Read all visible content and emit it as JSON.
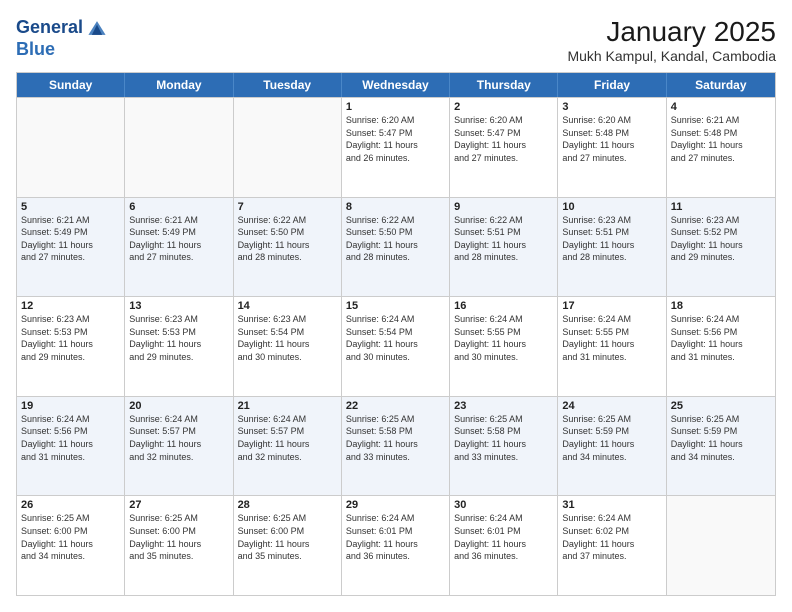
{
  "logo": {
    "line1": "General",
    "line2": "Blue"
  },
  "title": "January 2025",
  "subtitle": "Mukh Kampul, Kandal, Cambodia",
  "dayHeaders": [
    "Sunday",
    "Monday",
    "Tuesday",
    "Wednesday",
    "Thursday",
    "Friday",
    "Saturday"
  ],
  "weeks": [
    {
      "alt": false,
      "days": [
        {
          "num": "",
          "info": ""
        },
        {
          "num": "",
          "info": ""
        },
        {
          "num": "",
          "info": ""
        },
        {
          "num": "1",
          "info": "Sunrise: 6:20 AM\nSunset: 5:47 PM\nDaylight: 11 hours\nand 26 minutes."
        },
        {
          "num": "2",
          "info": "Sunrise: 6:20 AM\nSunset: 5:47 PM\nDaylight: 11 hours\nand 27 minutes."
        },
        {
          "num": "3",
          "info": "Sunrise: 6:20 AM\nSunset: 5:48 PM\nDaylight: 11 hours\nand 27 minutes."
        },
        {
          "num": "4",
          "info": "Sunrise: 6:21 AM\nSunset: 5:48 PM\nDaylight: 11 hours\nand 27 minutes."
        }
      ]
    },
    {
      "alt": true,
      "days": [
        {
          "num": "5",
          "info": "Sunrise: 6:21 AM\nSunset: 5:49 PM\nDaylight: 11 hours\nand 27 minutes."
        },
        {
          "num": "6",
          "info": "Sunrise: 6:21 AM\nSunset: 5:49 PM\nDaylight: 11 hours\nand 27 minutes."
        },
        {
          "num": "7",
          "info": "Sunrise: 6:22 AM\nSunset: 5:50 PM\nDaylight: 11 hours\nand 28 minutes."
        },
        {
          "num": "8",
          "info": "Sunrise: 6:22 AM\nSunset: 5:50 PM\nDaylight: 11 hours\nand 28 minutes."
        },
        {
          "num": "9",
          "info": "Sunrise: 6:22 AM\nSunset: 5:51 PM\nDaylight: 11 hours\nand 28 minutes."
        },
        {
          "num": "10",
          "info": "Sunrise: 6:23 AM\nSunset: 5:51 PM\nDaylight: 11 hours\nand 28 minutes."
        },
        {
          "num": "11",
          "info": "Sunrise: 6:23 AM\nSunset: 5:52 PM\nDaylight: 11 hours\nand 29 minutes."
        }
      ]
    },
    {
      "alt": false,
      "days": [
        {
          "num": "12",
          "info": "Sunrise: 6:23 AM\nSunset: 5:53 PM\nDaylight: 11 hours\nand 29 minutes."
        },
        {
          "num": "13",
          "info": "Sunrise: 6:23 AM\nSunset: 5:53 PM\nDaylight: 11 hours\nand 29 minutes."
        },
        {
          "num": "14",
          "info": "Sunrise: 6:23 AM\nSunset: 5:54 PM\nDaylight: 11 hours\nand 30 minutes."
        },
        {
          "num": "15",
          "info": "Sunrise: 6:24 AM\nSunset: 5:54 PM\nDaylight: 11 hours\nand 30 minutes."
        },
        {
          "num": "16",
          "info": "Sunrise: 6:24 AM\nSunset: 5:55 PM\nDaylight: 11 hours\nand 30 minutes."
        },
        {
          "num": "17",
          "info": "Sunrise: 6:24 AM\nSunset: 5:55 PM\nDaylight: 11 hours\nand 31 minutes."
        },
        {
          "num": "18",
          "info": "Sunrise: 6:24 AM\nSunset: 5:56 PM\nDaylight: 11 hours\nand 31 minutes."
        }
      ]
    },
    {
      "alt": true,
      "days": [
        {
          "num": "19",
          "info": "Sunrise: 6:24 AM\nSunset: 5:56 PM\nDaylight: 11 hours\nand 31 minutes."
        },
        {
          "num": "20",
          "info": "Sunrise: 6:24 AM\nSunset: 5:57 PM\nDaylight: 11 hours\nand 32 minutes."
        },
        {
          "num": "21",
          "info": "Sunrise: 6:24 AM\nSunset: 5:57 PM\nDaylight: 11 hours\nand 32 minutes."
        },
        {
          "num": "22",
          "info": "Sunrise: 6:25 AM\nSunset: 5:58 PM\nDaylight: 11 hours\nand 33 minutes."
        },
        {
          "num": "23",
          "info": "Sunrise: 6:25 AM\nSunset: 5:58 PM\nDaylight: 11 hours\nand 33 minutes."
        },
        {
          "num": "24",
          "info": "Sunrise: 6:25 AM\nSunset: 5:59 PM\nDaylight: 11 hours\nand 34 minutes."
        },
        {
          "num": "25",
          "info": "Sunrise: 6:25 AM\nSunset: 5:59 PM\nDaylight: 11 hours\nand 34 minutes."
        }
      ]
    },
    {
      "alt": false,
      "days": [
        {
          "num": "26",
          "info": "Sunrise: 6:25 AM\nSunset: 6:00 PM\nDaylight: 11 hours\nand 34 minutes."
        },
        {
          "num": "27",
          "info": "Sunrise: 6:25 AM\nSunset: 6:00 PM\nDaylight: 11 hours\nand 35 minutes."
        },
        {
          "num": "28",
          "info": "Sunrise: 6:25 AM\nSunset: 6:00 PM\nDaylight: 11 hours\nand 35 minutes."
        },
        {
          "num": "29",
          "info": "Sunrise: 6:24 AM\nSunset: 6:01 PM\nDaylight: 11 hours\nand 36 minutes."
        },
        {
          "num": "30",
          "info": "Sunrise: 6:24 AM\nSunset: 6:01 PM\nDaylight: 11 hours\nand 36 minutes."
        },
        {
          "num": "31",
          "info": "Sunrise: 6:24 AM\nSunset: 6:02 PM\nDaylight: 11 hours\nand 37 minutes."
        },
        {
          "num": "",
          "info": ""
        }
      ]
    }
  ]
}
